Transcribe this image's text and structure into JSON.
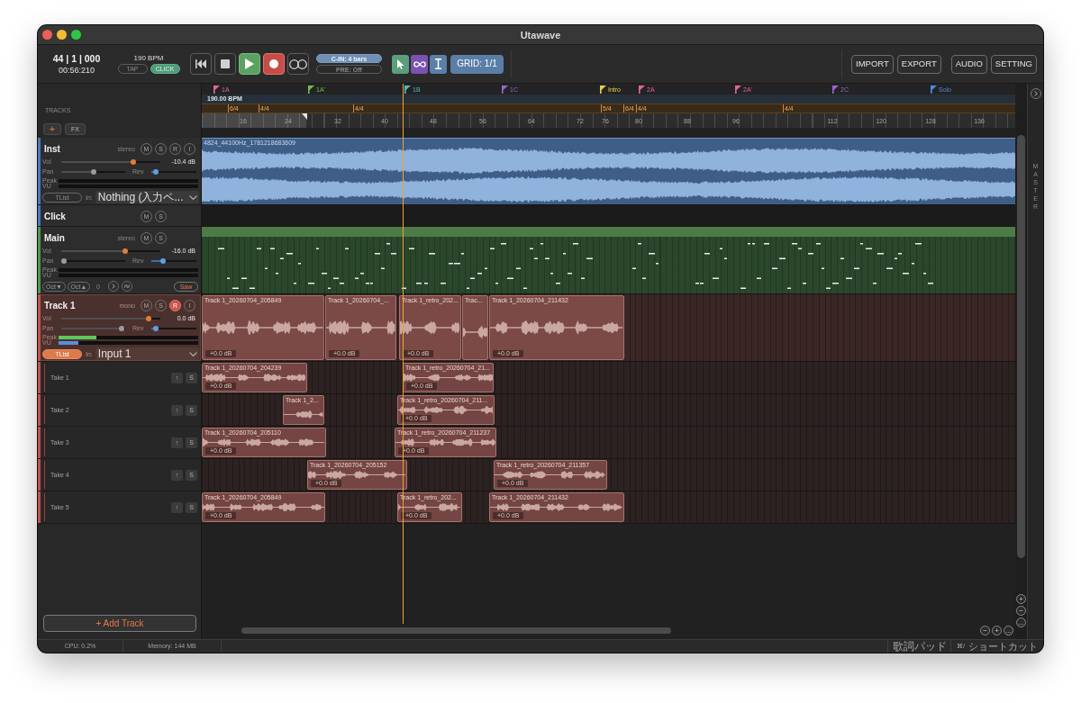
{
  "window": {
    "title": "Utawave"
  },
  "transport": {
    "position": "44 | 1 | 000",
    "time": "00:56:210",
    "tempo": "190 BPM",
    "tap": {
      "label": "TAP",
      "on": false
    },
    "click": {
      "label": "CLICK",
      "on": true
    },
    "buttons": [
      {
        "kind": "rewind",
        "on": false
      },
      {
        "kind": "stop",
        "on": false
      },
      {
        "kind": "play",
        "on": true
      },
      {
        "kind": "record",
        "on": true
      },
      {
        "kind": "loop",
        "on": false
      }
    ],
    "count_in": {
      "label": "C-IN: 4 bars",
      "on": true
    },
    "pre_roll": {
      "label": "PRE: Off",
      "on": false
    }
  },
  "tools": [
    {
      "kind": "pointer",
      "color": "#5a9f79"
    },
    {
      "kind": "loop",
      "color": "#7b51b4"
    },
    {
      "kind": "text",
      "color": "#5a7fa8"
    }
  ],
  "grid": {
    "label": "GRID: 1/1"
  },
  "file_buttons": [
    "IMPORT",
    "EXPORT"
  ],
  "settings_buttons": [
    "AUDIO",
    "SETTING"
  ],
  "sidebar": {
    "heading": "TRACKS",
    "add_button": "+",
    "fx_button": "FX",
    "add_track": "+ Add Track"
  },
  "tracks": [
    {
      "kind": "audio",
      "name": "Inst",
      "channels": "stereo",
      "color": "#4a78c4",
      "selected": false,
      "buttons": [
        {
          "kind": "mute",
          "label": "M",
          "on": false
        },
        {
          "kind": "solo",
          "label": "S",
          "on": false
        },
        {
          "kind": "record",
          "label": "R",
          "on": false
        },
        {
          "kind": "input",
          "label": "I",
          "on": false
        }
      ],
      "volume": {
        "label": "Vol",
        "level": 0.74,
        "reading": "-10.4 dB"
      },
      "pan": {
        "label": "Pan",
        "level": 0.5
      },
      "reverb": {
        "label": "Rev",
        "level": 0.04
      },
      "peak": {
        "label": "Peak"
      },
      "vu": {
        "label": "VU"
      },
      "take_list": {
        "label": "TList",
        "on": false
      },
      "input": {
        "label": "In:",
        "value": "Nothing (入力ペ..."
      },
      "region": {
        "kind": "audio",
        "name": "4824_44100Hz_1781218683609"
      }
    },
    {
      "kind": "click",
      "name": "Click",
      "color": "#4a78c4",
      "selected": false,
      "buttons": [
        {
          "kind": "mute",
          "label": "M",
          "on": false
        },
        {
          "kind": "solo",
          "label": "S",
          "on": false
        }
      ]
    },
    {
      "kind": "instrument",
      "name": "Main",
      "channels": "stereo",
      "color": "#4e9a4c",
      "selected": false,
      "buttons": [
        {
          "kind": "mute",
          "label": "M",
          "on": false
        },
        {
          "kind": "solo",
          "label": "S",
          "on": false
        }
      ],
      "volume": {
        "label": "Vol",
        "level": 0.65,
        "reading": "-16.0 dB"
      },
      "pan": {
        "label": "Pan",
        "level": 0
      },
      "reverb": {
        "label": "Rev",
        "level": 0.22
      },
      "peak": {
        "label": "Peak"
      },
      "vu": {
        "label": "VU"
      },
      "octave_down": "Oct▼",
      "octave_up": "Oct▲",
      "octave": "0",
      "synth": "Saw",
      "region": {
        "kind": "midi"
      }
    },
    {
      "kind": "audio",
      "name": "Track 1",
      "channels": "mono",
      "color": "#c4524c",
      "selected": true,
      "buttons": [
        {
          "kind": "mute",
          "label": "M",
          "on": false
        },
        {
          "kind": "solo",
          "label": "S",
          "on": false
        },
        {
          "kind": "record",
          "label": "R",
          "on": true
        },
        {
          "kind": "input",
          "label": "I",
          "on": false
        }
      ],
      "volume": {
        "label": "Vol",
        "level": 0.9,
        "reading": "0.0 dB"
      },
      "pan": {
        "label": "Pan",
        "level": 0.98
      },
      "reverb": {
        "label": "Rev",
        "level": 0.04
      },
      "peak": {
        "label": "Peak",
        "level": 0.27
      },
      "vu": {
        "label": "VU",
        "level": 0.14
      },
      "take_list": {
        "label": "TList",
        "on": true
      },
      "input": {
        "label": "In:",
        "value": "Input 1"
      },
      "clips": [
        {
          "name": "Track 1_20260704_205849",
          "gain": "+0.0 dB"
        },
        {
          "name": "Track 1_20260704_...",
          "gain": "+0.0 dB"
        },
        {
          "name": "Track 1_retro_202...",
          "gain": "+0.0 dB"
        },
        {
          "name": "Trac..."
        },
        {
          "name": "Track 1_20260704_211432",
          "gain": "+0.0 dB"
        }
      ],
      "takes": [
        {
          "name": "Take 1",
          "buttons": [
            "↑",
            "S"
          ],
          "clips": [
            {
              "name": "Track 1_20260704_204239",
              "gain": "+0.0 dB"
            },
            {
              "name": "Track 1_retro_20260704_21...",
              "gain": "+0.0 dB"
            }
          ]
        },
        {
          "name": "Take 2",
          "buttons": [
            "↑",
            "S"
          ],
          "clips": [
            {
              "name": "Track 1_2..."
            },
            {
              "name": "Track 1_retro_20260704_211...",
              "gain": "+0.0 dB"
            }
          ]
        },
        {
          "name": "Take 3",
          "buttons": [
            "↑",
            "S"
          ],
          "clips": [
            {
              "name": "Track 1_20260704_205110",
              "gain": "+0.0 dB"
            },
            {
              "name": "Track 1_retro_20260704_211237",
              "gain": "+0.0 dB"
            }
          ]
        },
        {
          "name": "Take 4",
          "buttons": [
            "↑",
            "S"
          ],
          "clips": [
            {
              "name": "Track 1_20260704_205152",
              "gain": "+0.0 dB"
            },
            {
              "name": "Track 1_retro_20260704_211357",
              "gain": "+0.0 dB"
            }
          ]
        },
        {
          "name": "Take 5",
          "buttons": [
            "↑",
            "S"
          ],
          "clips": [
            {
              "name": "Track 1_20260704_205849",
              "gain": "+0.0 dB"
            },
            {
              "name": "Track 1_retro_202...",
              "gain": "+0.0 dB"
            },
            {
              "name": "Track 1_20260704_211432",
              "gain": "+0.0 dB"
            }
          ]
        }
      ]
    }
  ],
  "timeline": {
    "markers": [
      {
        "label": "1A",
        "color": "#e2649e"
      },
      {
        "label": "1A'",
        "color": "#72c04e"
      },
      {
        "label": "1B",
        "color": "#4fbcc4"
      },
      {
        "label": "1C",
        "color": "#9a66d6"
      },
      {
        "label": "Intro",
        "color": "#e8d046"
      },
      {
        "label": "2A",
        "color": "#e2649e"
      },
      {
        "label": "2A'",
        "color": "#e2649e"
      },
      {
        "label": "2C",
        "color": "#9a66d6"
      },
      {
        "label": "Solo",
        "color": "#4f86e6"
      }
    ],
    "tempo": "190.00 BPM",
    "time_signatures": [
      "6/4",
      "4/4",
      "4/4",
      "5/4",
      "6/4",
      "4/4",
      "4/4"
    ],
    "ruler": [
      "16",
      "24",
      "32",
      "40",
      "48",
      "56",
      "64",
      "72",
      "76",
      "80",
      "88",
      "96",
      "112",
      "120",
      "128",
      "136"
    ]
  },
  "master": {
    "label": "MASTER"
  },
  "zoom_vertical": [
    "+",
    "−",
    "..."
  ],
  "zoom_horizontal": [
    "−",
    "+",
    "..."
  ],
  "status_bar": {
    "cpu": "CPU: 0.2%",
    "memory": "Memory: 144 MB",
    "lyrics_pad": "歌詞パッド",
    "shortcut": {
      "key": "⌘/",
      "label": "ショートカット"
    }
  }
}
